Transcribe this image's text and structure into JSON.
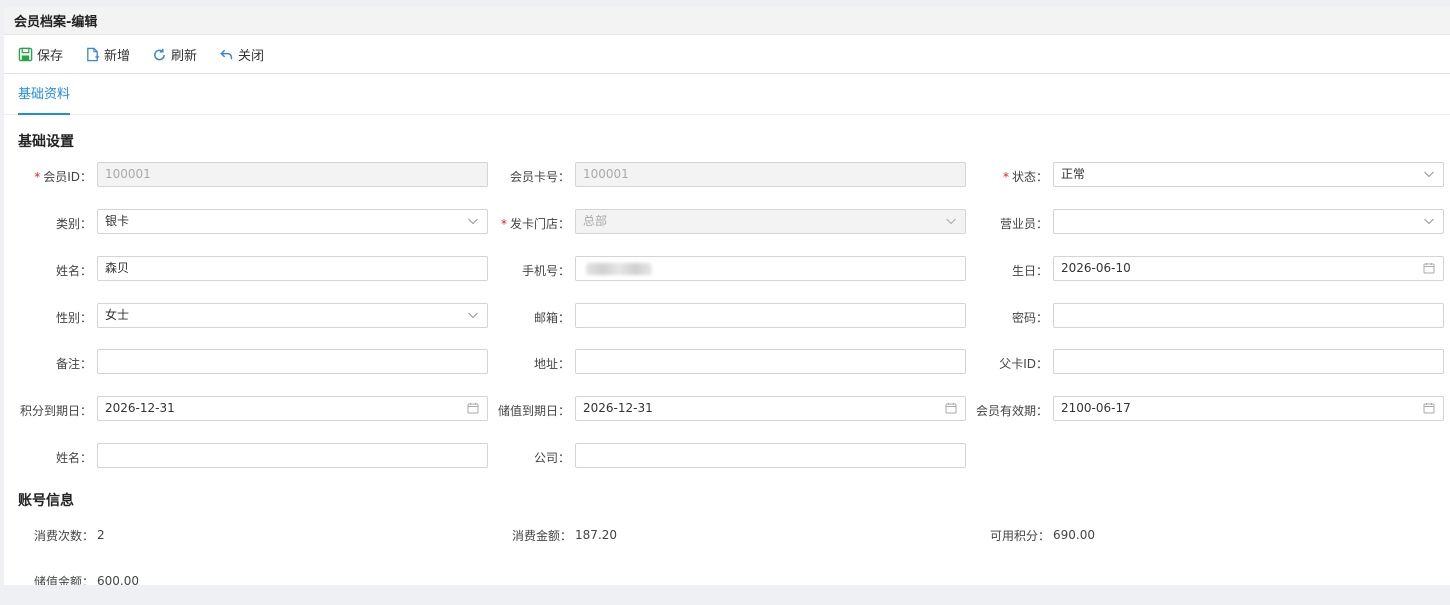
{
  "window": {
    "title": "会员档案-编辑"
  },
  "toolbar": {
    "save": "保存",
    "add": "新增",
    "refresh": "刷新",
    "close": "关闭"
  },
  "tabs": {
    "basic": "基础资料"
  },
  "sections": {
    "basic_settings": "基础设置",
    "account_info": "账号信息"
  },
  "form": {
    "member_id": {
      "label": "会员ID：",
      "value": "100001"
    },
    "card_no": {
      "label": "会员卡号：",
      "value": "100001"
    },
    "status": {
      "label": "状态：",
      "value": "正常"
    },
    "category": {
      "label": "类别：",
      "value": "银卡"
    },
    "issue_store": {
      "label": "发卡门店：",
      "value": "总部"
    },
    "salesperson": {
      "label": "营业员：",
      "value": ""
    },
    "name": {
      "label": "姓名：",
      "value": "森贝"
    },
    "phone": {
      "label": "手机号：",
      "value": ""
    },
    "birthday": {
      "label": "生日：",
      "value": "2026-06-10"
    },
    "gender": {
      "label": "性别：",
      "value": "女士"
    },
    "email": {
      "label": "邮箱：",
      "value": ""
    },
    "password": {
      "label": "密码：",
      "value": ""
    },
    "remark": {
      "label": "备注：",
      "value": ""
    },
    "address": {
      "label": "地址：",
      "value": ""
    },
    "parent_card": {
      "label": "父卡ID：",
      "value": ""
    },
    "points_expiry": {
      "label": "积分到期日：",
      "value": "2026-12-31"
    },
    "stored_expiry": {
      "label": "储值到期日：",
      "value": "2026-12-31"
    },
    "member_expiry": {
      "label": "会员有效期：",
      "value": "2100-06-17"
    },
    "name2": {
      "label": "姓名：",
      "value": ""
    },
    "company": {
      "label": "公司：",
      "value": ""
    }
  },
  "account": {
    "consume_count": {
      "label": "消费次数：",
      "value": "2"
    },
    "consume_amount": {
      "label": "消费金额：",
      "value": "187.20"
    },
    "available_points": {
      "label": "可用积分：",
      "value": "690.00"
    },
    "stored_amount": {
      "label": "储值金额：",
      "value": "600.00"
    }
  },
  "colors": {
    "accent": "#1f8ce0",
    "required": "#e02020",
    "save_icon": "#2aa34a"
  }
}
